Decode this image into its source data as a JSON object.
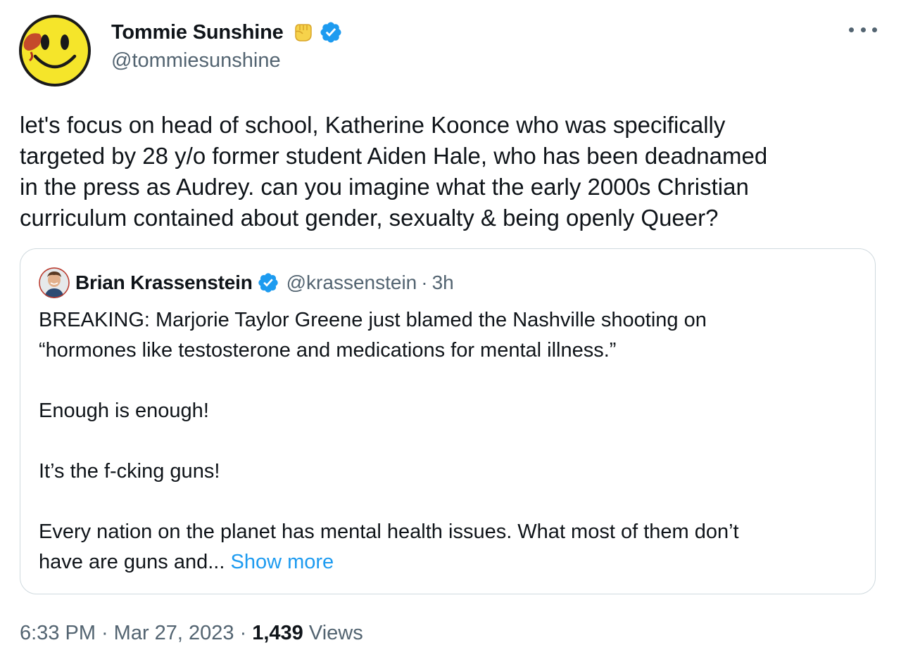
{
  "author": {
    "name": "Tommie Sunshine",
    "handle": "@tommiesunshine",
    "avatar_icon": "smiley-face-avatar",
    "name_emoji_icon": "raised-fist-icon",
    "verified_icon": "verified-badge-icon"
  },
  "more_icon": "more-options-icon",
  "tweet_text": "let's focus on head of school, Katherine Koonce who was specifically\ntargeted by 28 y/o former student Aiden Hale, who has been deadnamed\nin the press as Audrey. can you imagine what the early 2000s Christian\ncurriculum contained about gender, sexualty & being openly Queer?",
  "quote": {
    "name": "Brian Krassenstein",
    "handle": "@krassenstein",
    "separator": "·",
    "time": "3h",
    "paragraphs": [
      "BREAKING: Marjorie Taylor Greene just blamed the Nashville shooting on\n“hormones like testosterone and medications for mental illness.”",
      "Enough is enough!",
      "It’s the f-cking guns!"
    ],
    "last_paragraph": "Every nation on the planet has mental health issues. What most of them don’t\nhave are guns and... ",
    "show_more": "Show more"
  },
  "meta": {
    "time": "6:33 PM",
    "separator": "·",
    "date": "Mar 27, 2023",
    "views_count": "1,439",
    "views_label": "Views"
  },
  "colors": {
    "text": "#0f1419",
    "secondary": "#536471",
    "link": "#1d9bf0",
    "verified": "#1d9bf0",
    "border": "#cfd9de"
  }
}
